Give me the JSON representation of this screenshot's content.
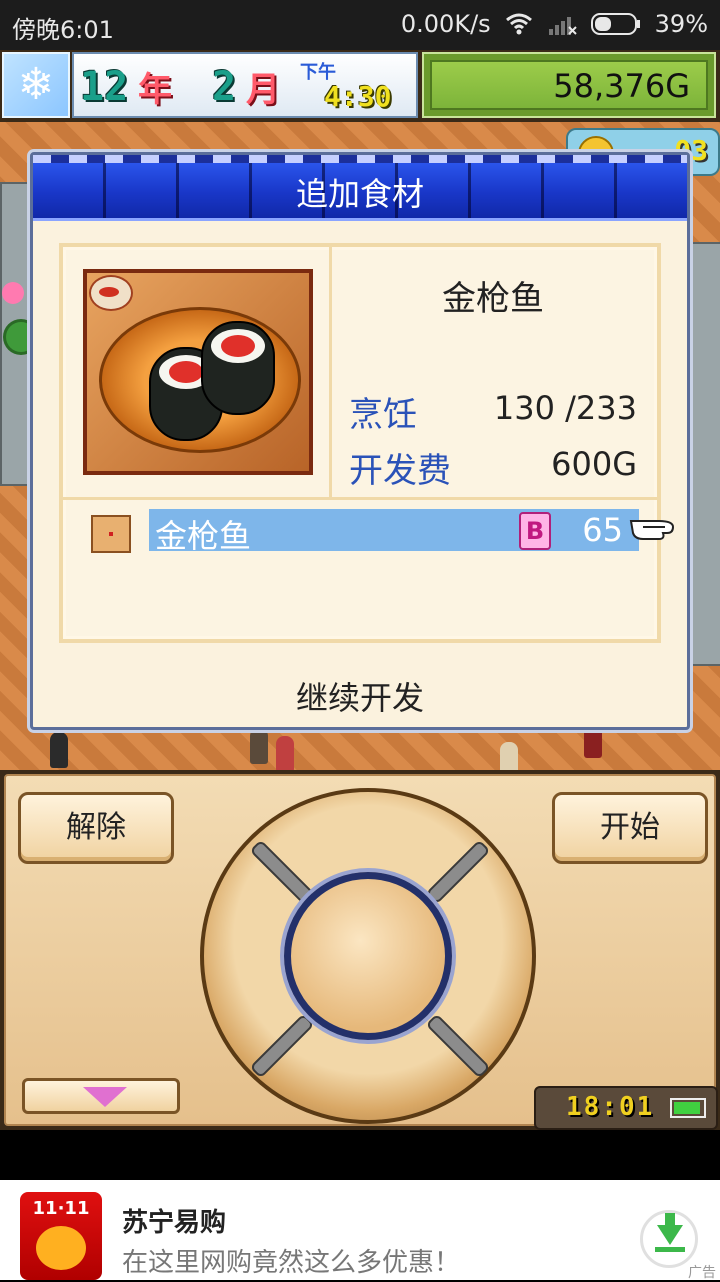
{
  "status_bar": {
    "time": "傍晚6:01",
    "net_speed": "0.00K/s",
    "battery_pct": "39%"
  },
  "hud": {
    "year_num": "12",
    "year_unit": "年",
    "month_num": "2",
    "month_unit": "月",
    "ampm": "下午",
    "clock": "4:30",
    "money": "58,376G",
    "coin_count": "03"
  },
  "dialog": {
    "title": "追加食材",
    "food_name": "金枪鱼",
    "stats": [
      {
        "label": "烹饪",
        "value": "130 /233"
      },
      {
        "label": "开发费",
        "value": "600G"
      }
    ],
    "ingredient": {
      "name": "金枪鱼",
      "rank": "B",
      "qty": "65"
    },
    "continue_label": "继续开发"
  },
  "controller": {
    "left_button": "解除",
    "right_button": "开始",
    "clock": "18:01"
  },
  "ad": {
    "logo_text": "11·11",
    "title": "苏宁易购",
    "subtitle": "在这里网购竟然这么多优惠！",
    "tag": "广告"
  },
  "colors": {
    "dialog_header": "#1937c8",
    "stat_label": "#2a52b8",
    "highlight_row": "#7eb6ea",
    "money_green": "#7db43a"
  }
}
